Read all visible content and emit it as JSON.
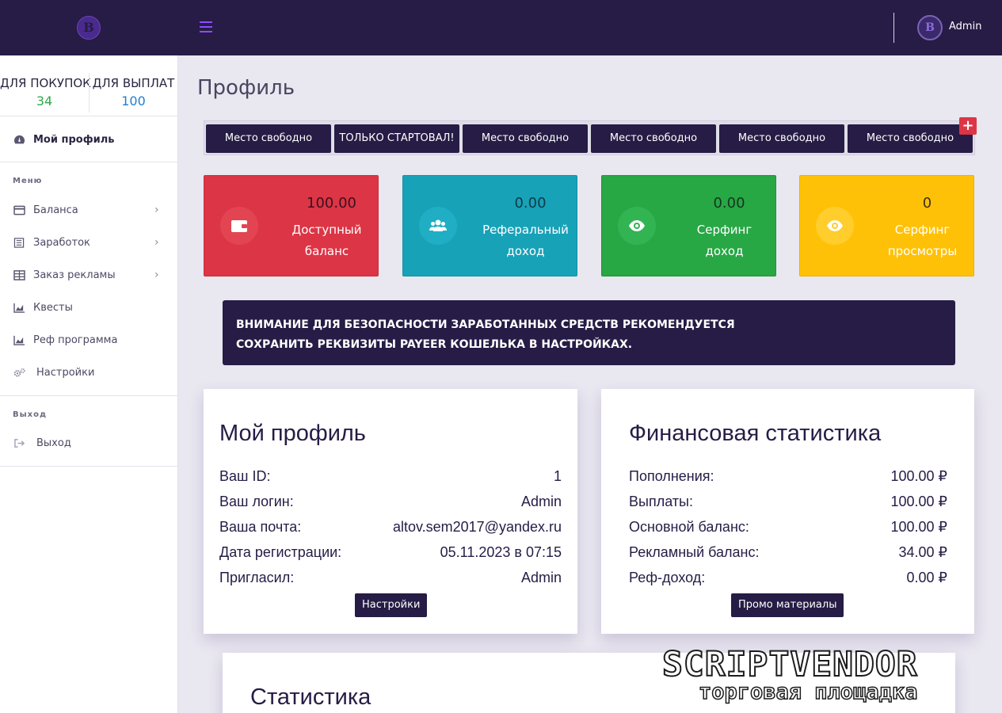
{
  "header": {
    "logo_letter": "B",
    "user_initial": "B",
    "user_name": "Admin"
  },
  "sidebar": {
    "balances": [
      {
        "label": "ДЛЯ ПОКУПОК",
        "value": "34",
        "color": "#2eaa4b"
      },
      {
        "label": "ДЛЯ ВЫПЛАТ",
        "value": "100",
        "color": "#1f7fd1"
      }
    ],
    "profile_item": {
      "label": "Мой профиль",
      "icon": "dashboard-icon"
    },
    "menu_heading": "Меню",
    "items": [
      {
        "label": "Баланса",
        "icon": "wallet-icon",
        "has_submenu": true
      },
      {
        "label": "Заработок",
        "icon": "list-icon",
        "has_submenu": true
      },
      {
        "label": "Заказ рекламы",
        "icon": "table-icon",
        "has_submenu": true
      },
      {
        "label": "Квесты",
        "icon": "chart-icon",
        "has_submenu": false
      },
      {
        "label": "Реф программа",
        "icon": "chart-icon",
        "has_submenu": false
      },
      {
        "label": "Настройки",
        "icon": "gears-icon",
        "has_submenu": false
      }
    ],
    "exit_heading": "Выход",
    "exit_item": {
      "label": "Выход",
      "icon": "sign-out-icon"
    }
  },
  "main": {
    "page_title": "Профиль",
    "ad_slots": [
      "Место свободно",
      "ТОЛЬКО СТАРТОВАЛ!",
      "Место свободно",
      "Место свободно",
      "Место свободно",
      "Место свободно"
    ],
    "add_ad_symbol": "+",
    "stat_cards": [
      {
        "value": "100.00",
        "label_line1": "Доступный",
        "label_line2": "баланс",
        "icon": "wallet-icon",
        "bg": "#dc3545",
        "circle": "#e0424f",
        "text_color": "#3b1020"
      },
      {
        "value": "0.00",
        "label_line1": "Реферальный",
        "label_line2": "доход",
        "icon": "users-icon",
        "bg": "#17a2b8",
        "circle": "#1daec3",
        "text_color": "#0f3a45"
      },
      {
        "value": "0.00",
        "label_line1": "Серфинг",
        "label_line2": "доход",
        "icon": "eye-icon",
        "bg": "#28a745",
        "circle": "#2fb24d",
        "text_color": "#12381c"
      },
      {
        "value": "0",
        "label_line1": "Серфинг",
        "label_line2": "просмотры",
        "icon": "eye-icon",
        "bg": "#ffc107",
        "circle": "#ffcd2c",
        "text_color": "#3d300a"
      }
    ],
    "alert": {
      "line1": "ВНИМАНИЕ ДЛЯ БЕЗОПАСНОСТИ ЗАРАБОТАННЫХ СРЕДСТВ РЕКОМЕНДУЕТСЯ",
      "line2": "СОХРАНИТЬ РЕКВИЗИТЫ PAYEER КОШЕЛЬКА В НАСТРОЙКАХ."
    },
    "profile_panel": {
      "title": "Мой профиль",
      "rows": [
        {
          "key": "Ваш ID:",
          "value": "1"
        },
        {
          "key": "Ваш логин:",
          "value": "Admin"
        },
        {
          "key": "Ваша почта:",
          "value": "altov.sem2017@yandex.ru"
        },
        {
          "key": "Дата регистрации:",
          "value": "05.11.2023 в 07:15"
        },
        {
          "key": "Пригласил:",
          "value": "Admin"
        }
      ],
      "button": "Настройки"
    },
    "finance_panel": {
      "title": "Финансовая статистика",
      "rows": [
        {
          "key": "Пополнения:",
          "value": "100.00 ₽"
        },
        {
          "key": "Выплаты:",
          "value": "100.00 ₽"
        },
        {
          "key": "Основной баланс:",
          "value": "100.00 ₽"
        },
        {
          "key": "Рекламный баланс:",
          "value": "34.00 ₽"
        },
        {
          "key": "Реф-доход:",
          "value": "0.00 ₽"
        }
      ],
      "button": "Промо материалы"
    },
    "stats_panel": {
      "title": "Статистика"
    }
  },
  "watermark": {
    "line1": "SCRIPTVENDOR",
    "line2": "торговая площадка"
  }
}
